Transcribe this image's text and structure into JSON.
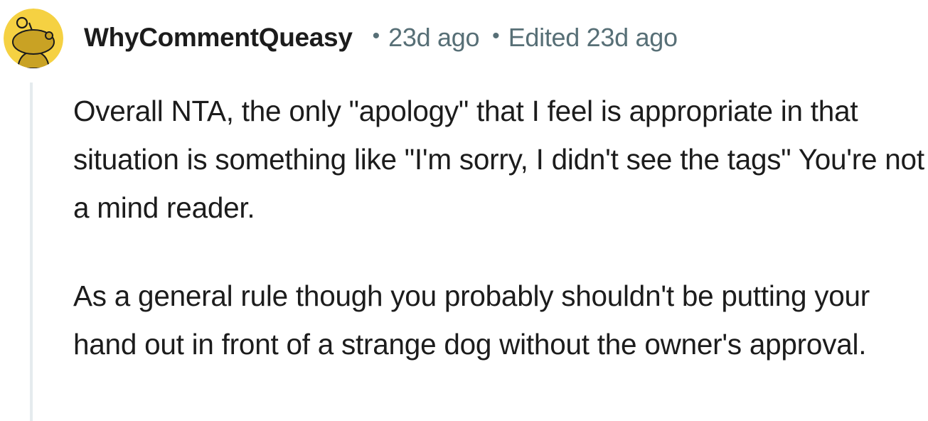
{
  "comment": {
    "avatar_icon": "reddit-snoo-avatar-icon",
    "avatar_color": "#d4a82a",
    "username": "WhyCommentQueasy",
    "separator": "•",
    "time": "23d ago",
    "edited": "Edited 23d ago",
    "paragraphs": [
      "Overall NTA, the only \"apology\" that I feel is appropriate in that situation is something like \"I'm sorry, I didn't see the tags\" You're not a mind reader.",
      "As a general rule though you probably shouldn't be putting your hand out in front of a strange dog without the owner's approval."
    ]
  }
}
